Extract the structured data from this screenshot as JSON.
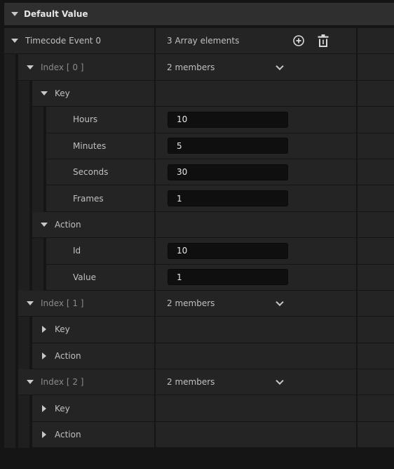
{
  "header": {
    "title": "Default Value"
  },
  "root": {
    "label": "Timecode Event 0",
    "value": "3 Array elements"
  },
  "index0": {
    "label": "Index [ 0 ]",
    "value": "2 members",
    "key": {
      "label": "Key",
      "fields": [
        {
          "label": "Hours",
          "value": "10"
        },
        {
          "label": "Minutes",
          "value": "5"
        },
        {
          "label": "Seconds",
          "value": "30"
        },
        {
          "label": "Frames",
          "value": "1"
        }
      ]
    },
    "action": {
      "label": "Action",
      "fields": [
        {
          "label": "Id",
          "value": "10"
        },
        {
          "label": "Value",
          "value": "1"
        }
      ]
    }
  },
  "index1": {
    "label": "Index [ 1 ]",
    "value": "2 members",
    "key_label": "Key",
    "action_label": "Action"
  },
  "index2": {
    "label": "Index [ 2 ]",
    "value": "2 members",
    "key_label": "Key",
    "action_label": "Action"
  },
  "icons": {
    "add": "add-circle-icon",
    "delete": "trash-icon",
    "expanded": "triangle-down-icon",
    "collapsed": "triangle-right-icon",
    "dropdown": "chevron-down-icon"
  }
}
